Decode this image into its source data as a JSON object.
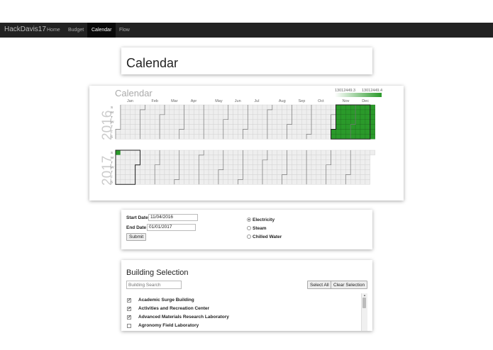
{
  "nav": {
    "brand": "HackDavis17",
    "items": [
      {
        "label": "Home",
        "active": false
      },
      {
        "label": "Budget",
        "active": false
      },
      {
        "label": "Calendar",
        "active": true
      },
      {
        "label": "Flow",
        "active": false
      }
    ]
  },
  "page_title": "Calendar",
  "calendar": {
    "title": "Calendar",
    "legend_min": "13012449.3",
    "legend_max": "13012449.4",
    "months": [
      "Jan",
      "Feb",
      "Mar",
      "Apr",
      "May",
      "Jun",
      "Jul",
      "Aug",
      "Sep",
      "Oct",
      "Nov",
      "Dec"
    ],
    "weekdays": [
      "S",
      "M",
      "T",
      "W",
      "T",
      "F",
      "S"
    ],
    "years": [
      "2016",
      "2017"
    ],
    "accent_color": "#2a9a2a",
    "empty_color": "#eeeeee",
    "selection_color": "#222222"
  },
  "form": {
    "start_label": "Start Date",
    "start_value": "11/04/2016",
    "end_label": "End Date",
    "end_value": "01/01/2017",
    "submit_label": "Submit",
    "options": [
      {
        "label": "Electricity",
        "selected": true
      },
      {
        "label": "Steam",
        "selected": false
      },
      {
        "label": "Chilled Water",
        "selected": false
      }
    ]
  },
  "buildings": {
    "title": "Building Selection",
    "search_placeholder": "Building Search",
    "select_all": "Select All",
    "clear_selection": "Clear Selection",
    "items": [
      {
        "label": "Academic Surge Building",
        "checked": true
      },
      {
        "label": "Activities and Recreation Center",
        "checked": true
      },
      {
        "label": "Advanced Materials Research Laboratory",
        "checked": true
      },
      {
        "label": "Agronomy Field Laboratory",
        "checked": false
      }
    ]
  }
}
